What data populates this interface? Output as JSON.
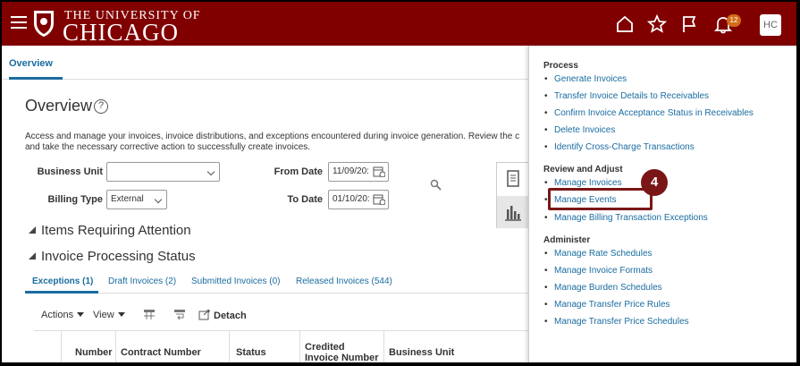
{
  "header": {
    "logo_top": "THE UNIVERSITY OF",
    "logo_main": "CHICAGO",
    "notification_count": "12",
    "avatar_initials": "HC",
    "brand_color": "#800000"
  },
  "tabs": {
    "overview": "Overview"
  },
  "page": {
    "title": "Overview",
    "description_line1": "Access and manage your invoices, invoice distributions, and exceptions encountered during invoice generation. Review the c",
    "description_line2": "and take the necessary corrective action to successfully create invoices."
  },
  "filters": {
    "business_unit_label": "Business Unit",
    "business_unit_value": "",
    "billing_type_label": "Billing Type",
    "billing_type_value": "External",
    "from_date_label": "From Date",
    "from_date_value": "11/09/20:",
    "to_date_label": "To Date",
    "to_date_value": "01/10/20:"
  },
  "sections": {
    "items_requiring_attention": "Items Requiring Attention",
    "invoice_processing_status": "Invoice Processing Status"
  },
  "subtabs": [
    {
      "label": "Exceptions (1)",
      "active": true
    },
    {
      "label": "Draft Invoices (2)"
    },
    {
      "label": "Submitted Invoices (0)"
    },
    {
      "label": "Released Invoices (544)"
    }
  ],
  "toolbar": {
    "actions": "Actions",
    "view": "View",
    "detach": "Detach"
  },
  "table": {
    "columns": [
      "Number",
      "Contract Number",
      "Status",
      "Credited",
      "Invoice Number",
      "Business Unit"
    ]
  },
  "panel": {
    "process_heading": "Process",
    "process_links": [
      "Generate Invoices",
      "Transfer Invoice Details to Receivables",
      "Confirm Invoice Acceptance Status in Receivables",
      "Delete Invoices",
      "Identify Cross-Charge Transactions"
    ],
    "review_heading": "Review and Adjust",
    "review_links": [
      "Manage Invoices",
      "Manage Events",
      "Manage Billing Transaction Exceptions"
    ],
    "admin_heading": "Administer",
    "admin_links": [
      "Manage Rate Schedules",
      "Manage Invoice Formats",
      "Manage Burden Schedules",
      "Manage Transfer Price Rules",
      "Manage Transfer Price Schedules"
    ],
    "callout_number": "4"
  }
}
